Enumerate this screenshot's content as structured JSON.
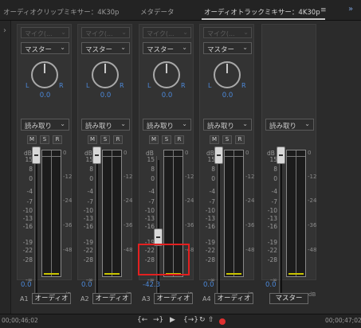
{
  "tabs": [
    {
      "label": "オーディオクリップミキサー：4K30p",
      "active": false
    },
    {
      "label": "メタデータ",
      "active": false
    },
    {
      "label": "オーディオトラックミキサー：4K30p",
      "active": true
    }
  ],
  "tab_menu_icon": "≡",
  "expand_icon": "»",
  "left_toggle": "›",
  "channels": [
    {
      "input": "マイク(...",
      "output": "マスター",
      "pan_left": "L",
      "pan_right": "R",
      "pan_value": "0.0",
      "automation": "読み取り",
      "m": "M",
      "s": "S",
      "r": "R",
      "volume": "0.0",
      "fader_db": 0,
      "id": "A1",
      "name": "オーディオ"
    },
    {
      "input": "マイク(...",
      "output": "マスター",
      "pan_left": "L",
      "pan_right": "R",
      "pan_value": "0.0",
      "automation": "読み取り",
      "m": "M",
      "s": "S",
      "r": "R",
      "volume": "0.0",
      "fader_db": 0,
      "id": "A2",
      "name": "オーディオ"
    },
    {
      "input": "マイク(...",
      "output": "マスター",
      "pan_left": "L",
      "pan_right": "R",
      "pan_value": "0.0",
      "automation": "読み取り",
      "m": "M",
      "s": "S",
      "r": "R",
      "volume": "-42.3",
      "fader_db": -42.3,
      "id": "A3",
      "name": "オーディオ"
    },
    {
      "input": "マイク(...",
      "output": "マスター",
      "pan_left": "L",
      "pan_right": "R",
      "pan_value": "0.0",
      "automation": "読み取り",
      "m": "M",
      "s": "S",
      "r": "R",
      "volume": "0.0",
      "fader_db": 0,
      "id": "A4",
      "name": "オーディオ"
    }
  ],
  "master": {
    "automation": "読み取り",
    "volume": "0.0",
    "fader_db": 0,
    "name": "マスター"
  },
  "fader_scale_label": "dB",
  "fader_scale": [
    "15",
    "8",
    "0",
    "-4",
    "-7",
    "-10",
    "-13",
    "-16",
    "-19",
    "-22",
    "-28",
    "-∞"
  ],
  "meter_scale": [
    "0",
    "-12",
    "-24",
    "-36",
    "-48"
  ],
  "meter_db_label": "dB",
  "highlight_color": "#e32020",
  "timecode_start": "00;00;46;02",
  "timecode_end": "00;00;47;02",
  "transport": {
    "to_in": "{←",
    "play_in_out": "→}",
    "play": "▶",
    "loop": "{→}",
    "loop2": "↻",
    "export": "⇧"
  }
}
